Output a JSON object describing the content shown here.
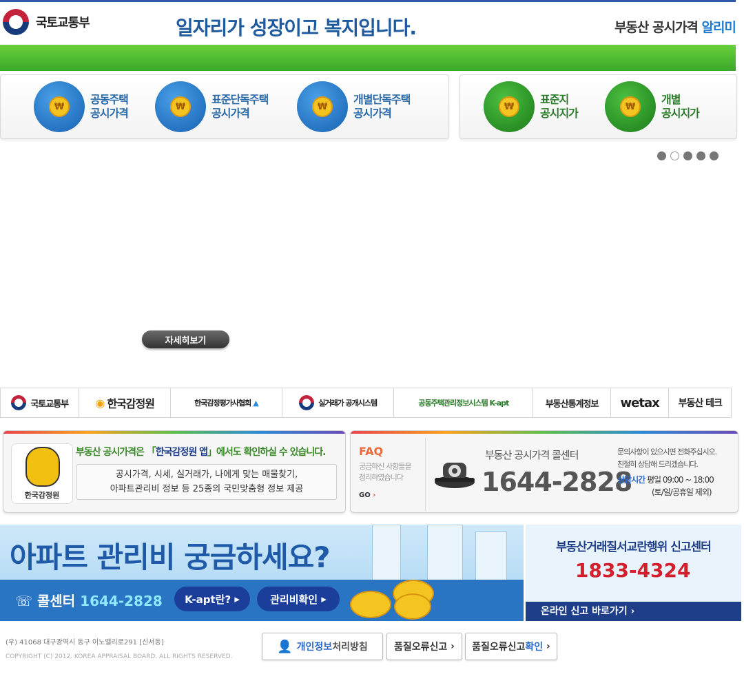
{
  "header": {
    "logo": "국토교통부",
    "slogan": "일자리가 성장이고 복지입니다.",
    "service_title": "부동산 공시가격",
    "service_title_hl": "알리미"
  },
  "quick_menu": [
    {
      "line1": "공동주택",
      "line2": "공시가격",
      "icon": "apartment-icon"
    },
    {
      "line1": "표준단독주택",
      "line2": "공시가격",
      "icon": "house-icon"
    },
    {
      "line1": "개별단독주택",
      "line2": "공시가격",
      "icon": "home-icon"
    },
    {
      "line1": "표준지",
      "line2": "공시지가",
      "icon": "map-korea-icon"
    },
    {
      "line1": "개별",
      "line2": "공시지가",
      "icon": "map-pin-icon"
    }
  ],
  "more_button": "자세히보기",
  "links": [
    "국토교통부",
    "한국감정원",
    "한국감정평가사협회",
    "실거래가 공개시스템",
    "공동주택관리정보시스템 K-apt",
    "부동산통계정보",
    "wetax",
    "부동산 테크"
  ],
  "app_box": {
    "icon_label": "한국감정원",
    "headline_pre": "부동산 공시가격은 「",
    "headline_app": "한국감정원 앱",
    "headline_post": "」에서도 확인하실 수 있습니다.",
    "desc_line1": "공시가격, 시세, 실거래가, 나에게 맞는 매물찾기,",
    "desc_line2": "아파트관리비 정보 등 25종의 국민맞춤형 정보 제공"
  },
  "call_center": {
    "faq_title": "FAQ",
    "faq_desc1": "궁금하신 사항들을",
    "faq_desc2": "정리하였습니다",
    "faq_go": "GO",
    "title": "부동산 공시가격 콜센터",
    "number": "1644-2828",
    "note1": "문의사항이 있으시면 전화주십시오.",
    "note2": "친절히 상담해 드리겠습니다.",
    "hours_label": "상담시간",
    "hours": "평일 09:00 ~ 18:00",
    "hours_note": "(토/일/공휴일 제외)"
  },
  "banner_kapt": {
    "title": "아파트 관리비 궁금하세요?",
    "call_label": "콜센터",
    "call_number": "1644-2828",
    "btn1": "K-apt란?",
    "btn2": "관리비확인"
  },
  "banner_report": {
    "title": "부동산거래질서교란행위 신고센터",
    "number": "1833-4324",
    "link": "온라인 신고 바로가기"
  },
  "footer": {
    "address": "(우) 41068  대구광역시 동구 이노밸리로291 [신서동]",
    "copyright": "COPYRIGHT (C) 2012. KOREA APPRAISAL BOARD. ALL RIGHTS RESERVED.",
    "privacy_hl": "개인정보",
    "privacy_rest": "처리방침",
    "quality_report": "품질오류신고",
    "quality_check_pre": "품질오류신고",
    "quality_check_hl": "확인"
  },
  "colors": {
    "brand_blue": "#1e5a9e",
    "green": "#3aa82a",
    "accent": "#2a6ac8",
    "alert_red": "#d4202c"
  }
}
